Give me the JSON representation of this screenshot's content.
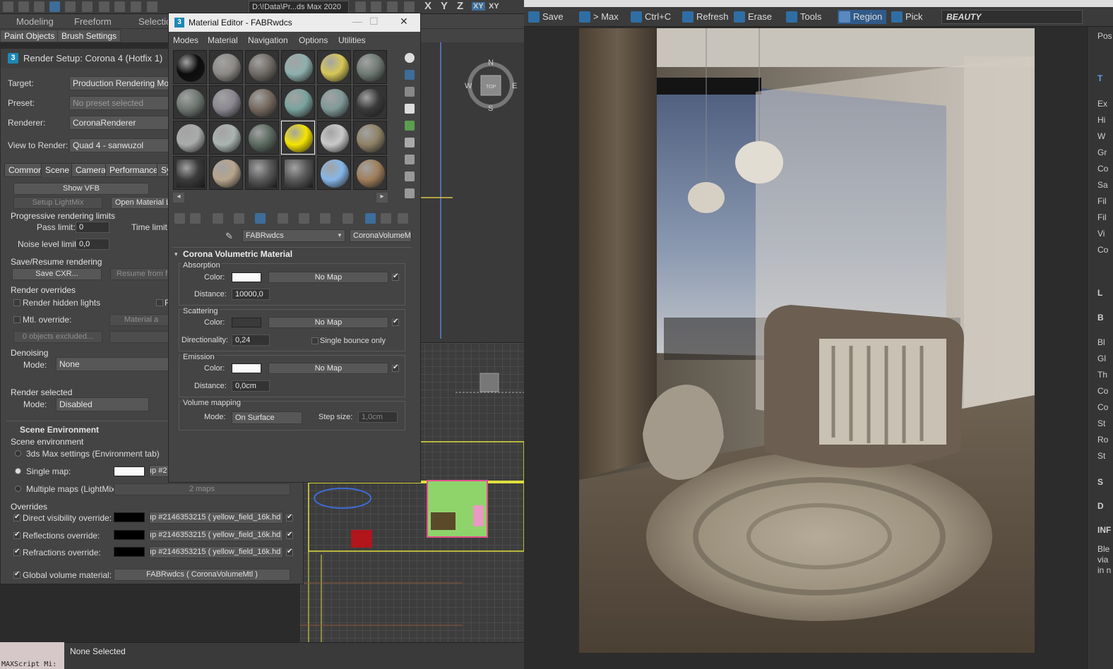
{
  "max": {
    "top_path": "D:\\!Data\\Pr...ds Max 2020",
    "axis_labels": [
      "X",
      "Y",
      "Z",
      "XY",
      "XY"
    ],
    "menu": [
      "Modeling",
      "Freeform",
      "Selection"
    ],
    "ribbon": [
      "Paint Objects",
      "Brush Settings"
    ],
    "status_text": "None Selected",
    "maxscript_text": "MAXScript Mi:"
  },
  "render_setup": {
    "title": "Render Setup: Corona 4 (Hotfix 1)",
    "target_label": "Target:",
    "target_value": "Production Rendering Mode",
    "preset_label": "Preset:",
    "preset_value": "No preset selected",
    "renderer_label": "Renderer:",
    "renderer_value": "CoronaRenderer",
    "view_label": "View to Render:",
    "view_value": "Quad 4 - sanwuzol",
    "tabs": [
      "Common",
      "Scene",
      "Camera",
      "Performance",
      "Sy"
    ],
    "show_vfb": "Show VFB",
    "setup_lightmix": "Setup LightMix",
    "open_material": "Open Material L",
    "prog_title": "Progressive rendering limits",
    "pass_limit_label": "Pass limit:",
    "pass_limit_value": "0",
    "time_limit_label": "Time limit:",
    "noise_label": "Noise level limit:",
    "noise_value": "0,0",
    "save_resume_title": "Save/Resume rendering",
    "save_cxr": "Save CXR...",
    "resume_from": "Resume from f",
    "overrides_title": "Render overrides",
    "hidden_lights": "Render hidden lights",
    "hidden_lights_r": "R",
    "mtl_override": "Mtl. override:",
    "material_btn": "Material a",
    "excluded": "0 objects excluded...",
    "denoise_title": "Denoising",
    "denoise_mode_label": "Mode:",
    "denoise_mode": "None",
    "render_sel_title": "Render selected",
    "render_sel_mode_label": "Mode:",
    "render_sel_mode": "Disabled",
    "scene_env_title": "Scene Environment",
    "scene_env_sub": "Scene environment",
    "opt_3ds": "3ds Max settings (Environment tab)",
    "opt_single": "Single map:",
    "single_map_value": "ıp #2",
    "opt_multi": "Multiple maps (LightMix):",
    "multi_value": "2 maps",
    "env_overrides_title": "Overrides",
    "direct_vis": "Direct visibility override:",
    "reflections": "Reflections override:",
    "refractions": "Refractions override:",
    "override_map": "ıp #2146353215 ( yellow_field_16k.hd",
    "global_volume": "Global volume material:",
    "global_volume_value": "FABRwdcs  ( CoronaVolumeMtl )"
  },
  "material_editor": {
    "title": "Material Editor - FABRwdcs",
    "menu": [
      "Modes",
      "Material",
      "Navigation",
      "Options",
      "Utilities"
    ],
    "material_name": "FABRwdcs",
    "material_type": "CoronaVolumeMtl",
    "rollout_title": "Corona Volumetric Material",
    "absorption_title": "Absorption",
    "scattering_title": "Scattering",
    "emission_title": "Emission",
    "volume_mapping_title": "Volume mapping",
    "color_label": "Color:",
    "no_map": "No Map",
    "distance_label": "Distance:",
    "absorption_distance": "10000,0",
    "directionality_label": "Directionality:",
    "directionality_value": "0,24",
    "single_bounce": "Single bounce only",
    "emission_distance": "0,0cm",
    "mode_label": "Mode:",
    "mode_value": "On Surface",
    "step_label": "Step size:",
    "step_value": "1,0cm",
    "slot_colors": [
      "#0c0c0c",
      "#8d8a86",
      "#6f6a65",
      "#8fb0ad",
      "#d6c756",
      "#6f7a74",
      "#6e7670",
      "#8b8790",
      "#75695e",
      "#7aa39e",
      "#7f9a98",
      "#3a3a3a",
      "#a9acaa",
      "#aab4b0",
      "#5b6a60",
      "#f5e400",
      "#c9c9c9",
      "#8f8266",
      "#3b3b3b",
      "#b7a58c",
      "#5a5a5a",
      "#5a5a5a",
      "#86b6e8",
      "#a07e5b"
    ]
  },
  "vfb": {
    "buttons": [
      "Save",
      "> Max",
      "Ctrl+C",
      "Refresh",
      "Erase",
      "Tools",
      "Region",
      "Pick"
    ],
    "channel": "BEAUTY",
    "side_items": [
      "Pos",
      "T",
      "Ex",
      "Hi",
      "W",
      "Gr",
      "Co",
      "Sa",
      "Fil",
      "Fil",
      "Vi",
      "Co",
      "L",
      "B",
      "Bl",
      "Gl",
      "Th",
      "Co",
      "Co",
      "St",
      "Ro",
      "St",
      "S",
      "D",
      "INF",
      "Ble",
      "via",
      "in n"
    ]
  }
}
